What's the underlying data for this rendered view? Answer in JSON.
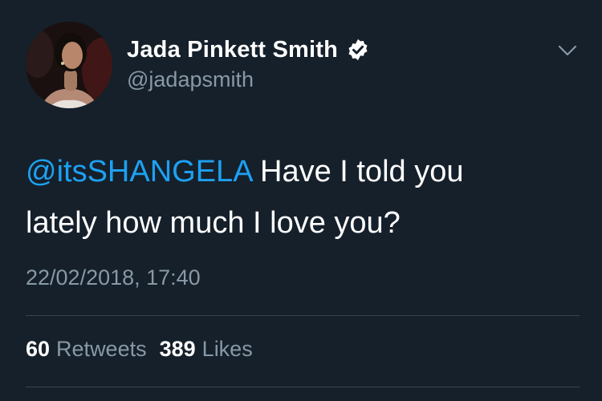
{
  "author": {
    "display_name": "Jada Pinkett Smith",
    "handle": "@jadapsmith",
    "verified": true,
    "avatar_icon": "profile-photo"
  },
  "tweet": {
    "mention": "@itsSHANGELA",
    "text_line1": " Have I told you",
    "text_line2": "lately how much I love you?",
    "timestamp": "22/02/2018, 17:40"
  },
  "stats": {
    "retweets_count": "60",
    "retweets_label": "Retweets",
    "likes_count": "389",
    "likes_label": "Likes"
  },
  "colors": {
    "background": "#15202b",
    "text": "#ffffff",
    "secondary": "#8899a6",
    "accent": "#1da1f2",
    "divider": "#38444d"
  },
  "icons": {
    "verified": "verified-badge-icon",
    "menu": "chevron-down-icon"
  }
}
